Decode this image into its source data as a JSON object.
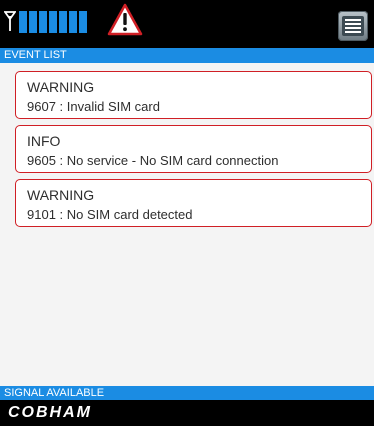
{
  "status_bar": {
    "signal_level_bars": 7,
    "icons": {
      "antenna": "antenna-icon",
      "warning": "warning-icon",
      "menu": "menu-icon"
    },
    "colors": {
      "accent": "#1b8ce3",
      "alert": "#d01f25"
    }
  },
  "header": {
    "title": "EVENT LIST"
  },
  "events": [
    {
      "level": "WARNING",
      "message": "9607 : Invalid SIM card"
    },
    {
      "level": "INFO",
      "message": "9605 : No service - No SIM card connection"
    },
    {
      "level": "WARNING",
      "message": "9101 : No SIM card detected"
    }
  ],
  "footer": {
    "status": "SIGNAL AVAILABLE",
    "brand": "COBHAM"
  }
}
